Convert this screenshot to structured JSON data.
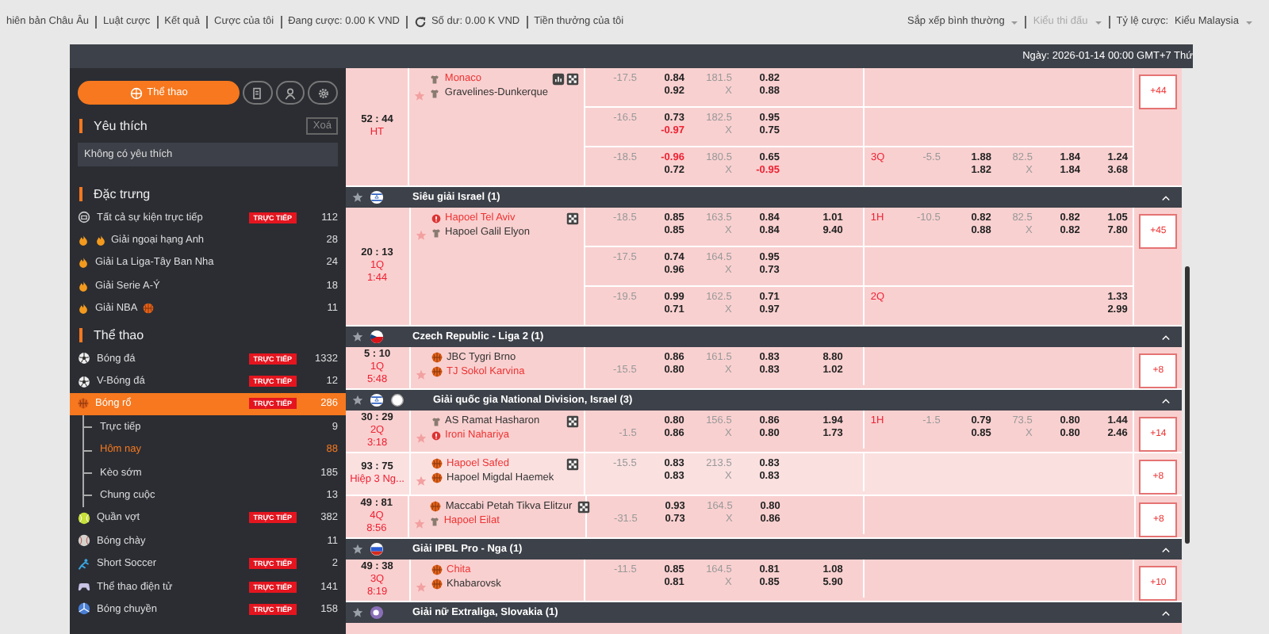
{
  "top_links": [
    {
      "kind": "link",
      "label": "hiên bản Châu Âu"
    },
    {
      "kind": "link",
      "label": "Luật cược"
    },
    {
      "kind": "link",
      "label": "Kết quả"
    },
    {
      "kind": "link",
      "label": "Cược của tôi"
    },
    {
      "kind": "link",
      "label": "Đang cược: 0.00 K VND"
    },
    {
      "kind": "refresh",
      "label": "Số dư: 0.00 K VND"
    },
    {
      "kind": "link",
      "label": "Tiền thưởng của tôi"
    }
  ],
  "top_dropdowns": [
    {
      "value": "Sắp xếp bình thường",
      "disabled": false
    },
    {
      "value": "Kiểu thi đấu",
      "disabled": true
    },
    {
      "label": "Tỷ lệ cược:",
      "value": "Kiểu Malaysia",
      "disabled": false
    }
  ],
  "date_header": "Ngày: 2026-01-14 00:00 GMT+7 Thứ",
  "sidebar": {
    "tabs": [
      {
        "kind": "sports",
        "label": "Thể thao",
        "selected": true
      },
      {
        "kind": "receipt",
        "selected": false
      },
      {
        "kind": "person",
        "selected": false
      },
      {
        "kind": "settings",
        "selected": false
      }
    ],
    "favorites": {
      "title": "Yêu thích",
      "clear": "Xoá",
      "empty": "Không có yêu thích"
    },
    "sections": [
      {
        "title": "Đặc trưng",
        "items": [
          {
            "kind": "live",
            "label": "Tất cả sự kiện trực tiếp",
            "live": "TRỰC TIẾP",
            "count": "112",
            "selected": false
          },
          {
            "kind": "fire",
            "label": "Giải ngoại hạng Anh",
            "count": "28",
            "selected": false
          },
          {
            "kind": "fire",
            "label": "Giải La Liga-Tây Ban Nha",
            "count": "24",
            "selected": false
          },
          {
            "kind": "fire",
            "label": "Giải Serie A-Ý",
            "count": "18",
            "selected": false
          },
          {
            "kind": "fire",
            "label": "Giải NBA",
            "count": "11",
            "selected": false
          }
        ]
      },
      {
        "title": "Thể thao",
        "items": [
          {
            "kind": "soccer",
            "label": "Bóng đá",
            "live": "TRỰC TIẾP",
            "count": "1332",
            "selected": false
          },
          {
            "kind": "soccer",
            "label": "V-Bóng đá",
            "live": "TRỰC TIẾP",
            "count": "12",
            "selected": false
          },
          {
            "kind": "basketball",
            "label": "Bóng rổ",
            "live": "TRỰC TIẾP",
            "count": "286",
            "selected": true,
            "children": [
              {
                "label": "Trực tiếp",
                "count": "9",
                "selected": false
              },
              {
                "label": "Hôm nay",
                "count": "88",
                "selected": true
              },
              {
                "label": "Kèo sớm",
                "count": "185",
                "selected": false
              },
              {
                "label": "Chung cuộc",
                "count": "13",
                "selected": false
              }
            ]
          },
          {
            "kind": "tennis",
            "label": "Quần vợt",
            "live": "TRỰC TIẾP",
            "count": "382",
            "selected": false
          },
          {
            "kind": "baseball",
            "label": "Bóng chày",
            "count": "11",
            "selected": false
          },
          {
            "kind": "player",
            "label": "Short Soccer",
            "live": "TRỰC TIẾP",
            "count": "2",
            "selected": false
          },
          {
            "kind": "gamepad",
            "label": "Thể thao điện tử",
            "live": "TRỰC TIẾP",
            "count": "141",
            "selected": false
          },
          {
            "kind": "volleyball",
            "label": "Bóng chuyền",
            "live": "TRỰC TIẾP",
            "count": "158",
            "selected": false
          }
        ]
      }
    ]
  },
  "blocks": [
    {
      "kind": "match",
      "score": "52 : 44",
      "period": "HT",
      "hovered": false,
      "teams": [
        {
          "name": "Monaco",
          "highlight": true
        },
        {
          "name": "Gravelines-Dunkerque",
          "highlight": false
        }
      ],
      "more": "+44",
      "lines": [
        {
          "hdp_home": "-17.5",
          "hdp_odds": [
            "0.84",
            "0.92"
          ],
          "total": [
            "181.5",
            "X"
          ],
          "ou_odds": [
            "0.82",
            "0.88"
          ]
        },
        {
          "hdp_home": "-16.5",
          "hdp_odds": [
            "0.73",
            "-0.97"
          ],
          "hdp_odds_red": [
            false,
            true
          ],
          "total": [
            "182.5",
            "X"
          ],
          "ou_odds": [
            "0.95",
            "0.75"
          ]
        },
        {
          "hdp_home": "-18.5",
          "hdp_odds": [
            "-0.96",
            "0.72"
          ],
          "hdp_odds_red": [
            true,
            false
          ],
          "total": [
            "180.5",
            "X"
          ],
          "ou_odds": [
            "0.65",
            "-0.95"
          ],
          "ou_odds_red": [
            false,
            true
          ],
          "part": {
            "period": "3Q",
            "hdp_home": "-5.5",
            "hdp_odds": [
              "1.88",
              "1.82"
            ],
            "total": [
              "82.5",
              "X"
            ],
            "ou_odds": [
              "1.84",
              "1.84"
            ],
            "ml": [
              "1.24",
              "3.68"
            ]
          }
        }
      ]
    },
    {
      "kind": "league",
      "name": "Siêu giải Israel (1)",
      "expanded": true
    },
    {
      "kind": "match",
      "score": "20 : 13",
      "period": "1Q",
      "clock": "1:44",
      "hovered": false,
      "teams": [
        {
          "name": "Hapoel Tel Aviv",
          "highlight": true
        },
        {
          "name": "Hapoel Galil Elyon",
          "highlight": false
        }
      ],
      "more": "+45",
      "lines": [
        {
          "hdp_home": "-18.5",
          "hdp_odds": [
            "0.85",
            "0.85"
          ],
          "total": [
            "163.5",
            "X"
          ],
          "ou_odds": [
            "0.84",
            "0.84"
          ],
          "ml": [
            "1.01",
            "9.40"
          ],
          "part": {
            "period": "1H",
            "hdp_home": "-10.5",
            "hdp_odds": [
              "0.82",
              "0.88"
            ],
            "total": [
              "82.5",
              "X"
            ],
            "ou_odds": [
              "0.82",
              "0.82"
            ],
            "ml": [
              "1.05",
              "7.80"
            ]
          }
        },
        {
          "hdp_home": "-17.5",
          "hdp_odds": [
            "0.74",
            "0.96"
          ],
          "total": [
            "164.5",
            "X"
          ],
          "ou_odds": [
            "0.95",
            "0.73"
          ]
        },
        {
          "hdp_home": "-19.5",
          "hdp_odds": [
            "0.99",
            "0.71"
          ],
          "total": [
            "162.5",
            "X"
          ],
          "ou_odds": [
            "0.71",
            "0.97"
          ],
          "part": {
            "period": "2Q",
            "ml": [
              "1.33",
              "2.99"
            ]
          }
        }
      ]
    },
    {
      "kind": "league",
      "name": "Czech Republic - Liga 2 (1)",
      "expanded": true
    },
    {
      "kind": "match",
      "score": "5 : 10",
      "period": "1Q",
      "clock": "5:48",
      "hovered": false,
      "teams": [
        {
          "name": "JBC Tygri Brno",
          "highlight": false
        },
        {
          "name": "TJ Sokol Karvina",
          "highlight": true
        }
      ],
      "more": "+8",
      "lines": [
        {
          "hdp_away": "-15.5",
          "hdp_odds": [
            "0.86",
            "0.80"
          ],
          "total": [
            "161.5",
            "X"
          ],
          "ou_odds": [
            "0.83",
            "0.83"
          ],
          "ml": [
            "8.80",
            "1.02"
          ]
        }
      ]
    },
    {
      "kind": "league",
      "name": "Giải quốc gia National Division, Israel (3)",
      "expanded": true
    },
    {
      "kind": "match",
      "score": "30 : 29",
      "period": "2Q",
      "clock": "3:18",
      "hovered": false,
      "teams": [
        {
          "name": "AS Ramat Hasharon",
          "highlight": false
        },
        {
          "name": "Ironi Nahariya",
          "highlight": true
        }
      ],
      "more": "+14",
      "lines": [
        {
          "hdp_away": "-1.5",
          "hdp_odds": [
            "0.80",
            "0.86"
          ],
          "total": [
            "156.5",
            "X"
          ],
          "ou_odds": [
            "0.86",
            "0.80"
          ],
          "ml": [
            "1.94",
            "1.73"
          ],
          "part": {
            "period": "1H",
            "hdp_home": "-1.5",
            "hdp_odds": [
              "0.79",
              "0.85"
            ],
            "total": [
              "73.5",
              "X"
            ],
            "ou_odds": [
              "0.80",
              "0.80"
            ],
            "ml": [
              "1.44",
              "2.46"
            ]
          }
        }
      ]
    },
    {
      "kind": "match",
      "score": "93 : 75",
      "period": "Hiệp 3 Ng...",
      "hovered": true,
      "teams": [
        {
          "name": "Hapoel Safed",
          "highlight": true
        },
        {
          "name": "Hapoel Migdal Haemek",
          "highlight": false
        }
      ],
      "more": "+8",
      "lines": [
        {
          "hdp_home": "-15.5",
          "hdp_odds": [
            "0.83",
            "0.83"
          ],
          "total": [
            "213.5",
            "X"
          ],
          "ou_odds": [
            "0.83",
            "0.83"
          ]
        }
      ]
    },
    {
      "kind": "match",
      "score": "49 : 81",
      "period": "4Q",
      "clock": "8:56",
      "hovered": false,
      "teams": [
        {
          "name": "Maccabi Petah Tikva Elitzur",
          "highlight": false
        },
        {
          "name": "Hapoel Eilat",
          "highlight": true
        }
      ],
      "more": "+8",
      "lines": [
        {
          "hdp_away": "-31.5",
          "hdp_odds": [
            "0.93",
            "0.73"
          ],
          "total": [
            "164.5",
            "X"
          ],
          "ou_odds": [
            "0.80",
            "0.86"
          ]
        }
      ]
    },
    {
      "kind": "league",
      "name": "Giải IPBL Pro - Nga (1)",
      "expanded": true
    },
    {
      "kind": "match",
      "score": "49 : 38",
      "period": "3Q",
      "clock": "8:19",
      "hovered": false,
      "teams": [
        {
          "name": "Chita",
          "highlight": true
        },
        {
          "name": "Khabarovsk",
          "highlight": false
        }
      ],
      "more": "+10",
      "lines": [
        {
          "hdp_home": "-11.5",
          "hdp_odds": [
            "0.85",
            "0.81"
          ],
          "total": [
            "164.5",
            "X"
          ],
          "ou_odds": [
            "0.81",
            "0.85"
          ],
          "ml": [
            "1.08",
            "5.90"
          ]
        }
      ]
    },
    {
      "kind": "league",
      "name": "Giải nữ Extraliga, Slovakia (1)",
      "expanded": true
    }
  ]
}
